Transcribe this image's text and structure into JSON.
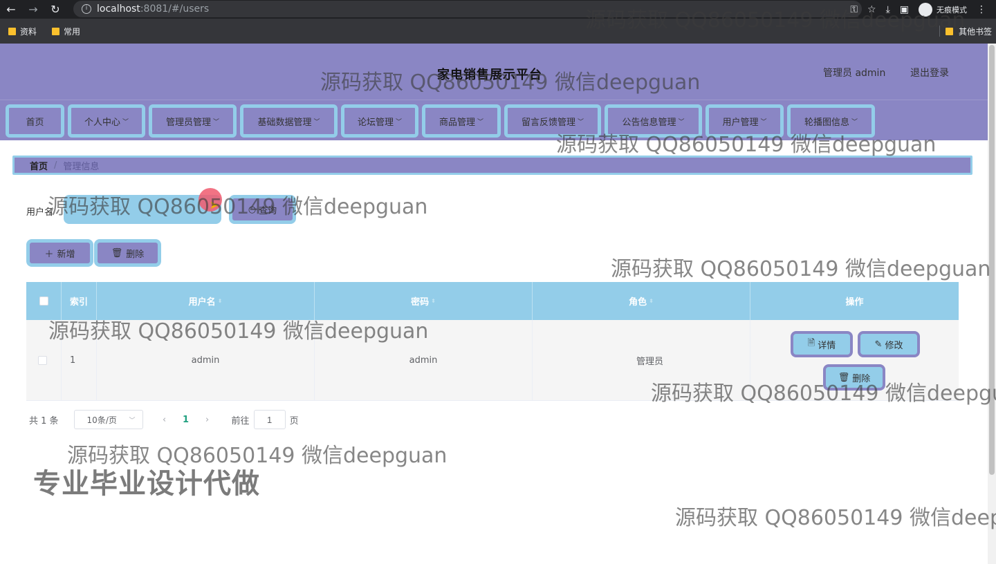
{
  "browser": {
    "url_host": "localhost",
    "url_rest": ":8081/#/users",
    "incognito_label": "无痕模式",
    "bookmarks": [
      "资料",
      "常用"
    ],
    "other_bookmarks": "其他书签"
  },
  "header": {
    "title": "家电销售展示平台",
    "admin_label": "管理员 admin",
    "logout": "退出登录"
  },
  "menu": [
    {
      "label": "首页",
      "chevron": false
    },
    {
      "label": "个人中心",
      "chevron": true
    },
    {
      "label": "管理员管理",
      "chevron": true
    },
    {
      "label": "基础数据管理",
      "chevron": true
    },
    {
      "label": "论坛管理",
      "chevron": true
    },
    {
      "label": "商品管理",
      "chevron": true
    },
    {
      "label": "留言反馈管理",
      "chevron": true
    },
    {
      "label": "公告信息管理",
      "chevron": true
    },
    {
      "label": "用户管理",
      "chevron": true
    },
    {
      "label": "轮播图信息",
      "chevron": true
    }
  ],
  "breadcrumb": {
    "home": "首页",
    "separator": "/",
    "current": "管理信息"
  },
  "search": {
    "label": "用户名",
    "value": "",
    "button": "查询"
  },
  "actions": {
    "add": "新增",
    "delete": "删除"
  },
  "table": {
    "headers": {
      "index": "索引",
      "username": "用户名",
      "password": "密码",
      "role": "角色",
      "ops": "操作"
    },
    "rows": [
      {
        "index": "1",
        "username": "admin",
        "password": "admin",
        "role": "管理员"
      }
    ],
    "row_buttons": {
      "detail": "详情",
      "edit": "修改",
      "delete": "删除"
    }
  },
  "pagination": {
    "total": "共 1 条",
    "page_size": "10条/页",
    "current_page": "1",
    "goto_label": "前往",
    "goto_value": "1",
    "page_suffix": "页"
  },
  "watermark": {
    "text": "源码获取 QQ86050149 微信deepguan",
    "banner": "专业毕业设计代做"
  },
  "colors": {
    "primary": "#8a86c4",
    "accent": "#93cde9",
    "page_active": "#20a080"
  }
}
